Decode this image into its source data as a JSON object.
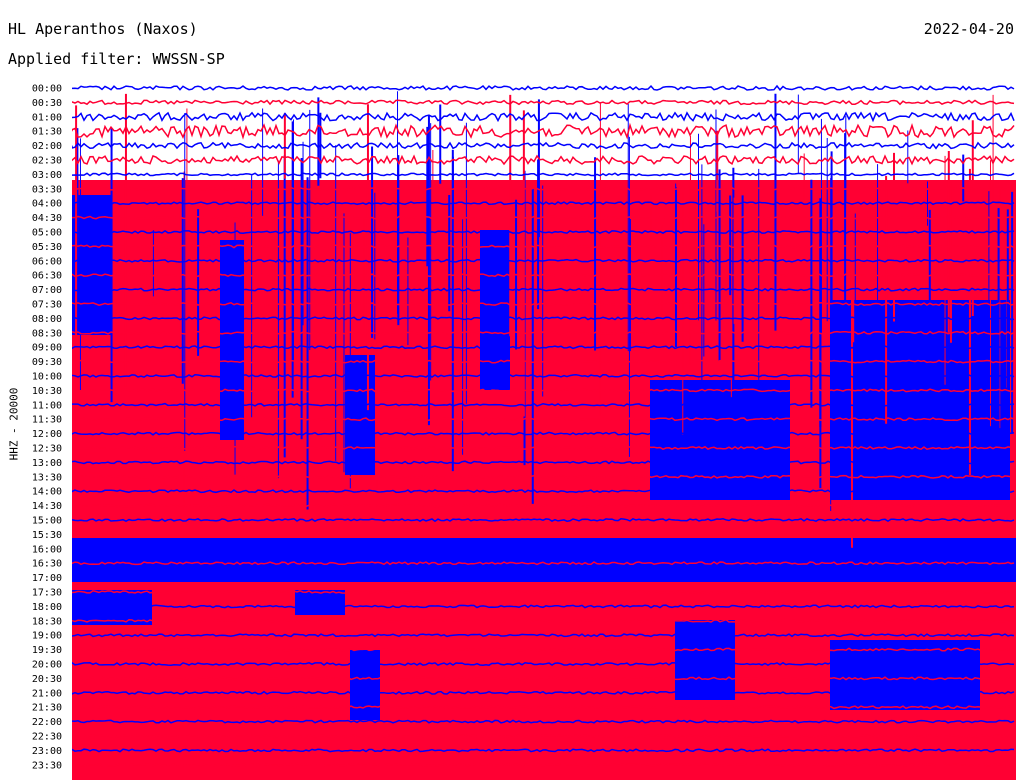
{
  "header": {
    "station": "HL Aperanthos (Naxos)",
    "date": "2022-04-20",
    "filter": "Applied filter: WWSSN-SP",
    "channel": "HHZ - 20000"
  },
  "colors": {
    "trace_a": "#0000ff",
    "trace_b": "#ff0033",
    "background": "#ffffff"
  },
  "chart_data": {
    "type": "line",
    "title": "HL Aperanthos (Naxos)",
    "ylabel": "HHZ - 20000",
    "y_tick_labels": [
      "00:00",
      "00:30",
      "01:00",
      "01:30",
      "02:00",
      "02:30",
      "03:00",
      "03:30",
      "04:00",
      "04:30",
      "05:00",
      "05:30",
      "06:00",
      "06:30",
      "07:00",
      "07:30",
      "08:00",
      "08:30",
      "09:00",
      "09:30",
      "10:00",
      "10:30",
      "11:00",
      "11:30",
      "12:00",
      "12:30",
      "13:00",
      "13:30",
      "14:00",
      "14:30",
      "15:00",
      "15:30",
      "16:00",
      "16:30",
      "17:00",
      "17:30",
      "18:00",
      "18:30",
      "19:00",
      "19:30",
      "20:00",
      "20:30",
      "21:00",
      "21:30",
      "22:00",
      "22:30",
      "23:00",
      "23:30"
    ],
    "trace_colors_alternating": [
      "#0000ff",
      "#ff0033"
    ],
    "x_unit": "minutes after row start",
    "x_range": [
      0,
      30
    ],
    "relative_amplitude_by_row": [
      0.5,
      0.5,
      1,
      1.5,
      0.7,
      1,
      0.3,
      0.3,
      0.3,
      0.3,
      0.3,
      0.3,
      0.3,
      0.3,
      0.3,
      0.3,
      0.3,
      0.3,
      0.3,
      0.3,
      0.3,
      0.3,
      0.3,
      0.3,
      0.3,
      0.3,
      0.3,
      0.3,
      0.3,
      0.3,
      0.3,
      0.3,
      0.3,
      0.3,
      0.3,
      0.3,
      0.3,
      0.3,
      0.3,
      0.3,
      0.3,
      0.3,
      0.3,
      0.3,
      0.3,
      0.3,
      0.3,
      0.3
    ],
    "background_noise": "saturated from about 03:30 to end of day"
  }
}
